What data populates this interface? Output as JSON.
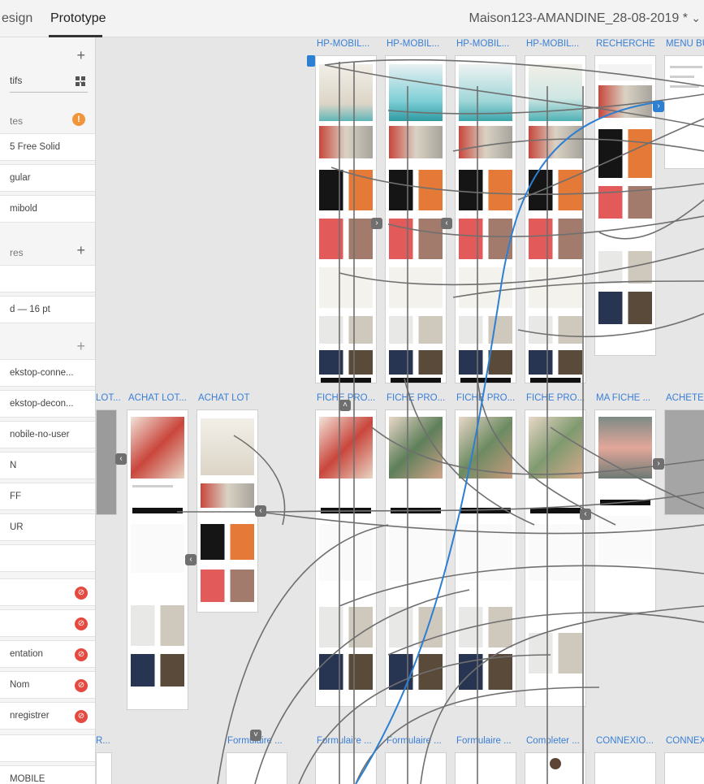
{
  "header": {
    "tabs": [
      {
        "label": "esign",
        "active": false
      },
      {
        "label": "Prototype",
        "active": true
      }
    ],
    "document_title": "Maison123-AMANDINE_28-08-2019 *"
  },
  "panel": {
    "select_value": "tifs",
    "sections": {
      "colors_label": "tes",
      "chars_label": "res",
      "components_plus": "+"
    },
    "fonts": [
      "5 Free Solid",
      "gular",
      "mibold"
    ],
    "char_styles": [
      "",
      "d — 16 pt"
    ],
    "states": [
      "ekstop-conne...",
      "ekstop-decon...",
      "nobile-no-user",
      "N",
      "FF",
      "UR",
      ""
    ],
    "linked_items": [
      "",
      "",
      "entation",
      "Nom",
      "nregistrer"
    ],
    "bottom_items": [
      "",
      "MOBILE"
    ]
  },
  "canvas": {
    "artboard_labels_top": [
      "HP-MOBIL...",
      "HP-MOBIL...",
      "HP-MOBIL...",
      "HP-MOBIL...",
      "RECHERCHE",
      "MENU BU"
    ],
    "artboard_labels_mid": [
      "LOT...",
      "ACHAT LOT...",
      "ACHAT LOT",
      "FICHE PRO...",
      "FICHE PRO...",
      "FICHE PRO...",
      "FICHE PRO...",
      "MA FICHE ...",
      "ACHETER"
    ],
    "artboard_labels_bottom": [
      "R...",
      "Formulaire ...",
      "Formulaire ...",
      "Formulaire ...",
      "Formulaire ...",
      "Completer ...",
      "CONNEXIO...",
      "CONNEXI"
    ]
  },
  "colors": {
    "accent": "#3a7fd6",
    "wire": "#6f6f6f",
    "wire_selected": "#2d7fd2",
    "warning": "#f0953b",
    "link_badge": "#e5493f"
  }
}
